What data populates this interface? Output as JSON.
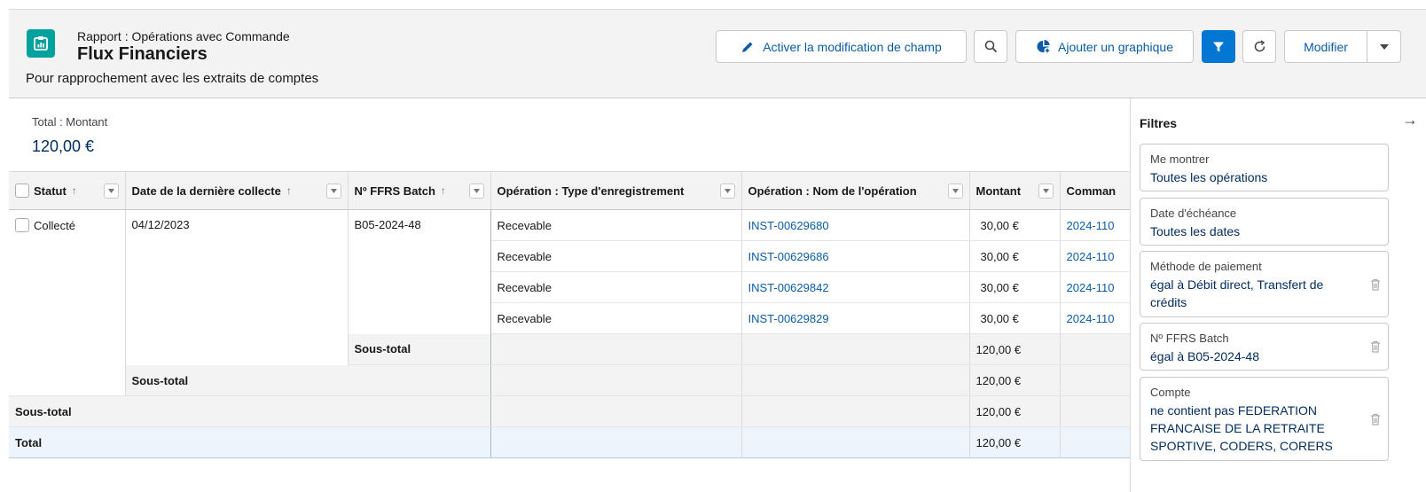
{
  "header": {
    "eyebrow": "Rapport : Opérations avec Commande",
    "title": "Flux Financiers",
    "description": "Pour rapprochement avec les extraits de comptes",
    "buttons": {
      "edit_field": "Activer la modification de champ",
      "add_chart": "Ajouter un graphique",
      "modify": "Modifier"
    }
  },
  "summary": {
    "label": "Total : Montant",
    "value": "120,00 €"
  },
  "table": {
    "columns": [
      "Statut",
      "Date de la dernière collecte",
      "Nº FFRS Batch",
      "Opération : Type d'enregistrement",
      "Opération : Nom de l'opération",
      "Montant",
      "Comman"
    ],
    "group": {
      "statut": "Collecté",
      "date": "04/12/2023",
      "batch": "B05-2024-48"
    },
    "rows": [
      {
        "type": "Recevable",
        "nom": "INST-00629680",
        "montant": "30,00 €",
        "commande": "2024-110"
      },
      {
        "type": "Recevable",
        "nom": "INST-00629686",
        "montant": "30,00 €",
        "commande": "2024-110"
      },
      {
        "type": "Recevable",
        "nom": "INST-00629842",
        "montant": "30,00 €",
        "commande": "2024-110"
      },
      {
        "type": "Recevable",
        "nom": "INST-00629829",
        "montant": "30,00 €",
        "commande": "2024-110"
      }
    ],
    "subtotal_label": "Sous-total",
    "subtotal_batch": "120,00 €",
    "subtotal_date": "120,00 €",
    "subtotal_statut": "120,00 €",
    "total_label": "Total",
    "total_value": "120,00 €"
  },
  "filters": {
    "title": "Filtres",
    "items": [
      {
        "label": "Me montrer",
        "value": "Toutes les opérations"
      },
      {
        "label": "Date d'échéance",
        "value": "Toutes les dates"
      },
      {
        "label": "Méthode de paiement",
        "value": "égal à Débit direct, Transfert de crédits"
      },
      {
        "label": "Nº FFRS Batch",
        "value": "égal à B05-2024-48"
      },
      {
        "label": "Compte",
        "value": "ne contient pas FEDERATION FRANCAISE DE LA RETRAITE SPORTIVE, CODERS, CORERS"
      }
    ]
  },
  "colors": {
    "brand": "#0176d3",
    "link": "#0b5cab",
    "app_icon": "#04a29e",
    "header_bg": "#f3f3f3"
  }
}
